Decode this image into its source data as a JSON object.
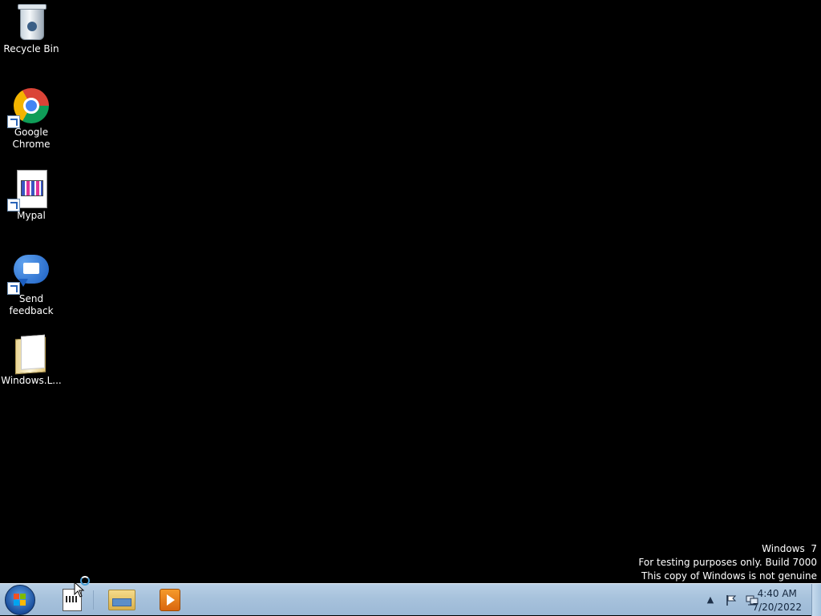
{
  "desktop": {
    "icons": [
      {
        "label": "Recycle Bin",
        "icon": "recycle-bin-icon"
      },
      {
        "label": "Google Chrome",
        "icon": "chrome-icon"
      },
      {
        "label": "Mypal",
        "icon": "mypal-icon"
      },
      {
        "label": "Send feedback",
        "icon": "feedback-icon"
      },
      {
        "label": "Windows.L...",
        "icon": "folder-icon"
      }
    ]
  },
  "watermark": {
    "line1": "Windows  7",
    "line2": "For testing purposes only. Build 7000",
    "line3": "This copy of Windows is not genuine"
  },
  "taskbar": {
    "start": "start-button",
    "pinned": [
      {
        "name": "Mypal",
        "icon": "mypal-icon"
      },
      {
        "name": "Windows Explorer",
        "icon": "explorer-icon"
      },
      {
        "name": "Windows Media Player",
        "icon": "media-player-icon"
      }
    ],
    "tray": {
      "show_hidden": "▲",
      "icons": [
        "action-center-icon",
        "network-icon"
      ]
    },
    "clock": {
      "time": "4:40 AM",
      "date": "7/20/2022"
    }
  }
}
